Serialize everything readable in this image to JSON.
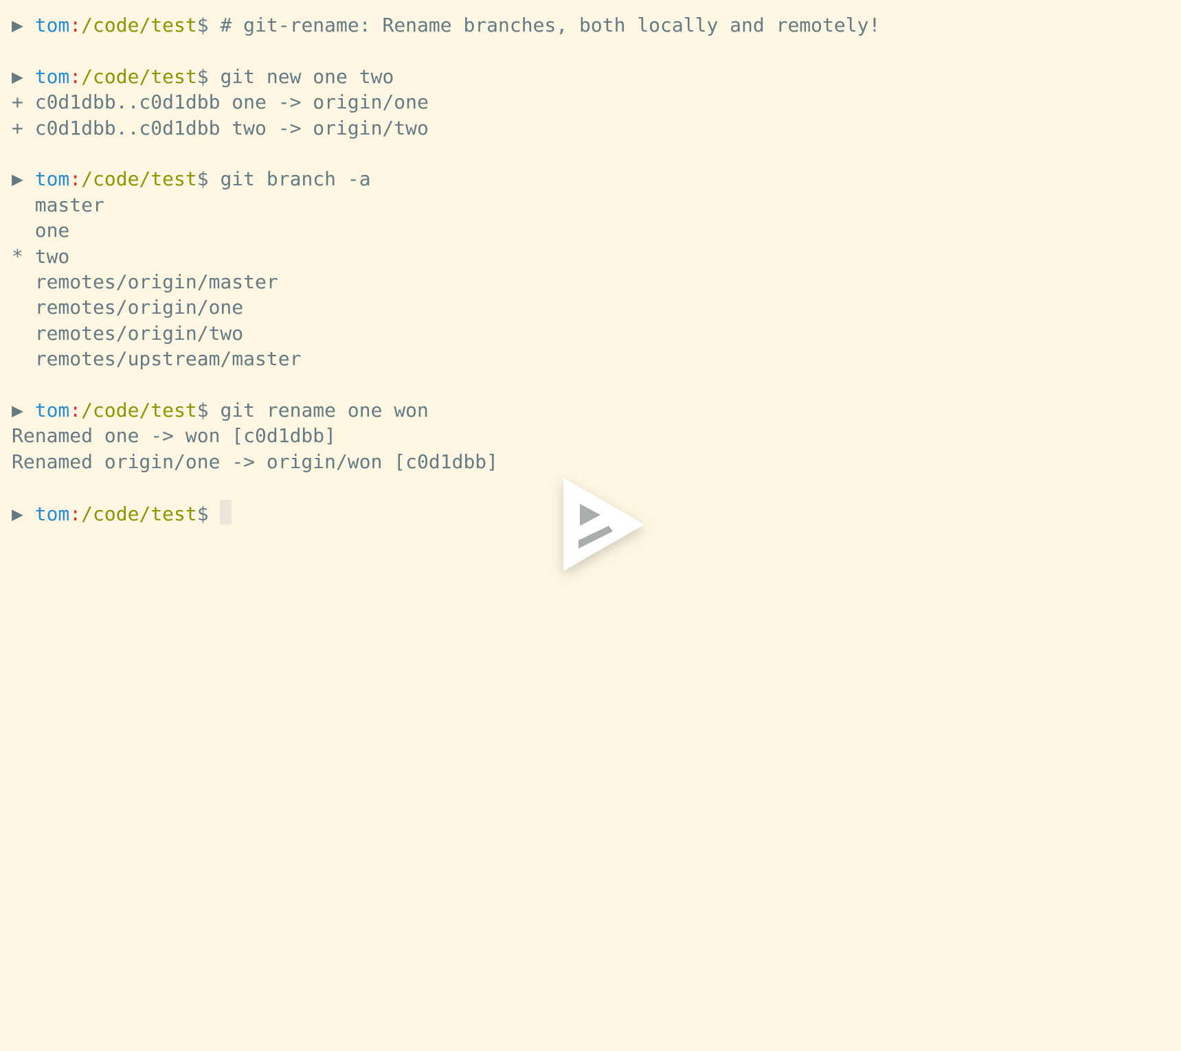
{
  "prompt": {
    "arrow": "▶",
    "user": "tom",
    "colon": ":",
    "path": "/code/test",
    "dollar": "$"
  },
  "blocks": [
    {
      "command": " # git-rename: Rename branches, both locally and remotely!",
      "output": []
    },
    {
      "command": " git new one two",
      "output": [
        "+ c0d1dbb..c0d1dbb one -> origin/one",
        "+ c0d1dbb..c0d1dbb two -> origin/two"
      ]
    },
    {
      "command": " git branch -a",
      "output": [
        "  master",
        "  one",
        "* two",
        "  remotes/origin/master",
        "  remotes/origin/one",
        "  remotes/origin/two",
        "  remotes/upstream/master"
      ]
    },
    {
      "command": " git rename one won",
      "output": [
        "Renamed one -> won [c0d1dbb]",
        "Renamed origin/one -> origin/won [c0d1dbb]"
      ]
    },
    {
      "command": " ",
      "output": [],
      "cursor": true
    }
  ],
  "player": {
    "play_icon": "asciinema-play-icon",
    "colors": {
      "background": "#fdf6e3",
      "foreground": "#657b83",
      "user": "#268bd2",
      "colon": "#dc322f",
      "path": "#859900"
    }
  }
}
